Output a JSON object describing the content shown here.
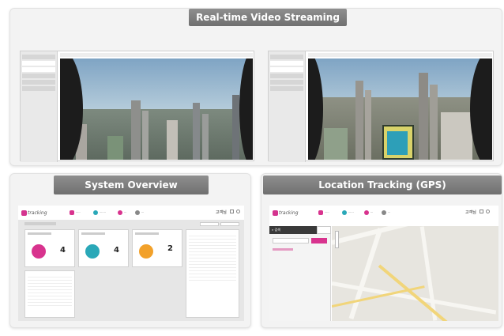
{
  "sections": {
    "video": {
      "title": "Real-time Video Streaming"
    },
    "overview": {
      "title": "System Overview"
    },
    "gps": {
      "title": "Location Tracking (GPS)"
    }
  },
  "app": {
    "brand": "tracking",
    "user_label": "고객님"
  },
  "colors": {
    "pink": "#d8338e",
    "teal": "#2aa8b8",
    "orange": "#f2a12a",
    "ribbon": "#7a7a7a"
  },
  "overview_stats": [
    {
      "value": "4"
    },
    {
      "value": "4"
    },
    {
      "value": "2"
    }
  ],
  "gps": {
    "search_placeholder": "검색"
  }
}
